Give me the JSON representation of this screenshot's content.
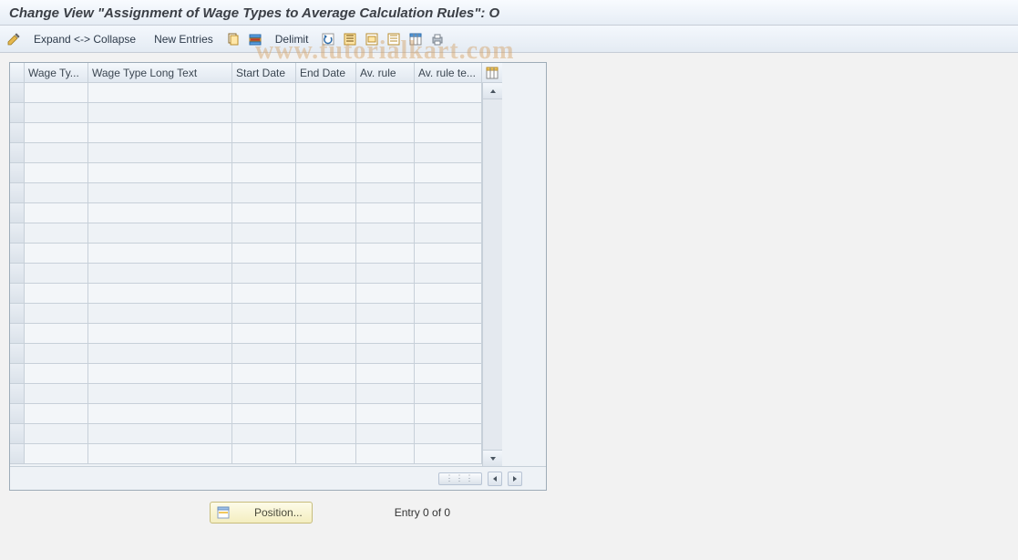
{
  "header": {
    "title": "Change View \"Assignment of Wage Types to Average Calculation Rules\": O"
  },
  "toolbar": {
    "expand_collapse": "Expand <-> Collapse",
    "new_entries": "New Entries",
    "delimit": "Delimit"
  },
  "grid": {
    "columns": {
      "wage_type": "Wage Ty...",
      "wage_type_long": "Wage Type Long Text",
      "start_date": "Start Date",
      "end_date": "End Date",
      "av_rule": "Av. rule",
      "av_rule_text": "Av. rule te..."
    },
    "row_count": 19
  },
  "footer": {
    "position_btn": "Position...",
    "entry_text": "Entry 0 of 0"
  },
  "watermark": "www.tutorialkart.com",
  "icons": {
    "pencil": "pencil-icon",
    "copy": "copy-icon",
    "delete_row": "delete-row-icon",
    "undo": "undo-icon",
    "select_all": "select-all-icon",
    "deselect": "deselect-icon",
    "print": "print-icon",
    "configure": "configure-columns-icon",
    "position": "position-icon"
  }
}
